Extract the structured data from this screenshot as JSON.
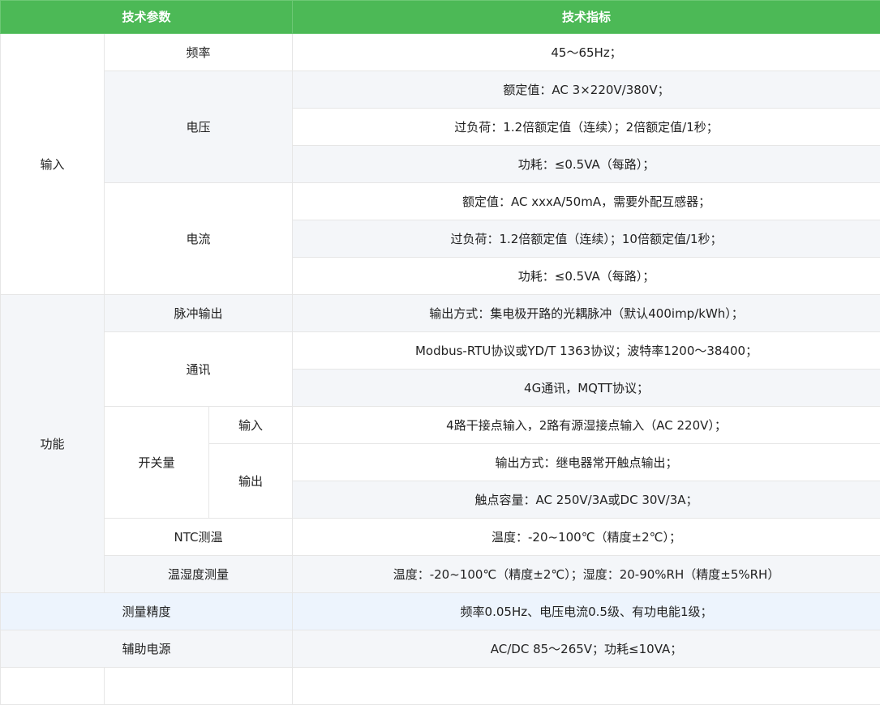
{
  "header": {
    "param": "技术参数",
    "spec": "技术指标"
  },
  "input": {
    "label": "输入",
    "freq": {
      "label": "频率",
      "value": "45～65Hz；"
    },
    "voltage": {
      "label": "电压",
      "values": [
        "额定值：AC 3×220V/380V；",
        "过负荷：1.2倍额定值（连续）；2倍额定值/1秒；",
        "功耗：≤0.5VA（每路）；"
      ]
    },
    "current": {
      "label": "电流",
      "values": [
        "额定值：AC xxxA/50mA，需要外配互感器；",
        "过负荷：1.2倍额定值（连续）；10倍额定值/1秒；",
        "功耗：≤0.5VA（每路）；"
      ]
    }
  },
  "function": {
    "label": "功能",
    "pulse": {
      "label": "脉冲输出",
      "value": "输出方式：集电极开路的光耦脉冲（默认400imp/kWh）；"
    },
    "comm": {
      "label": "通讯",
      "values": [
        "Modbus-RTU协议或YD/T 1363协议；波特率1200～38400；",
        "4G通讯，MQTT协议；"
      ]
    },
    "switch": {
      "label": "开关量",
      "input": {
        "label": "输入",
        "value": "4路干接点输入，2路有源湿接点输入（AC 220V）；"
      },
      "output": {
        "label": "输出",
        "values": [
          "输出方式：继电器常开触点输出；",
          "触点容量：AC 250V/3A或DC 30V/3A；"
        ]
      }
    },
    "ntc": {
      "label": "NTC测温",
      "value": "温度：-20~100℃（精度±2℃）；"
    },
    "th": {
      "label": "温湿度测量",
      "value": "温度：-20~100℃（精度±2℃）；湿度：20-90%RH（精度±5%RH）"
    }
  },
  "accuracy": {
    "label": "测量精度",
    "value": "频率0.05Hz、电压电流0.5级、有功电能1级；"
  },
  "aux_power": {
    "label": "辅助电源",
    "value": "AC/DC 85～265V；功耗≤10VA；"
  }
}
